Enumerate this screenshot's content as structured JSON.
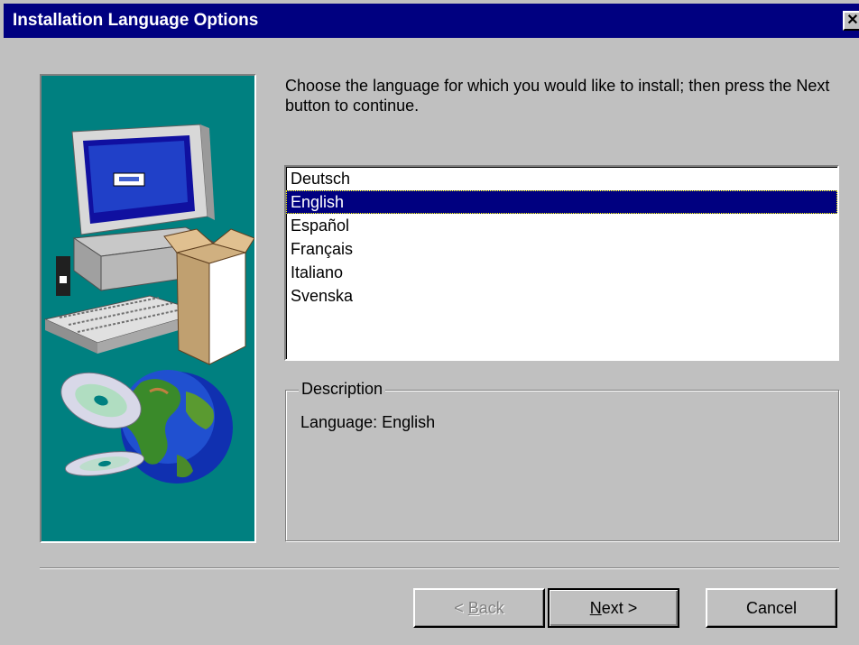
{
  "window": {
    "title": "Installation Language Options",
    "close_glyph": "✕"
  },
  "instruction": "Choose the language for which you would like to install; then press the Next button to continue.",
  "languages": {
    "items": [
      "Deutsch",
      "English",
      "Español",
      "Français",
      "Italiano",
      "Svenska"
    ],
    "selected": "English"
  },
  "description": {
    "legend": "Description",
    "text": "Language: English"
  },
  "buttons": {
    "back": {
      "prefix": "< ",
      "mnemonic": "B",
      "rest": "ack"
    },
    "next": {
      "mnemonic": "N",
      "rest": "ext >"
    },
    "cancel": "Cancel"
  },
  "colors": {
    "titlebar": "#000080",
    "dialog": "#c0c0c0",
    "panel": "#008080",
    "selection": "#000080"
  },
  "icons": [
    "computer-icon",
    "box-icon",
    "cd-icon",
    "globe-icon",
    "close-icon"
  ]
}
